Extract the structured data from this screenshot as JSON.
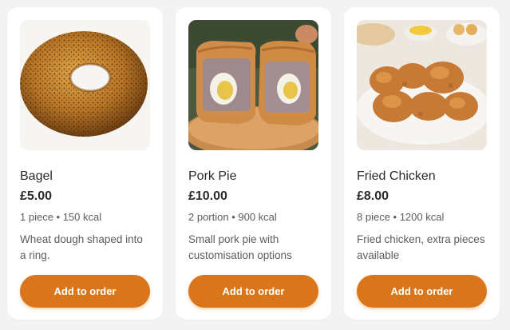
{
  "products": [
    {
      "name": "Bagel",
      "price": "£5.00",
      "meta": "1 piece • 150 kcal",
      "description": "Wheat dough shaped into a ring.",
      "button_label": "Add to order",
      "image": "bagel-photo"
    },
    {
      "name": "Pork Pie",
      "price": "£10.00",
      "meta": "2 portion • 900 kcal",
      "description": "Small pork pie with customisation options",
      "button_label": "Add to order",
      "image": "pork-pie-photo"
    },
    {
      "name": "Fried Chicken",
      "price": "£8.00",
      "meta": "8 piece • 1200 kcal",
      "description": "Fried chicken, extra pieces available",
      "button_label": "Add to order",
      "image": "fried-chicken-photo"
    }
  ],
  "colors": {
    "accent": "#d9761b",
    "card_background": "#ffffff",
    "page_background": "#f3f3f3",
    "text_primary": "#2a2a2a",
    "text_secondary": "#5c5c5c"
  }
}
